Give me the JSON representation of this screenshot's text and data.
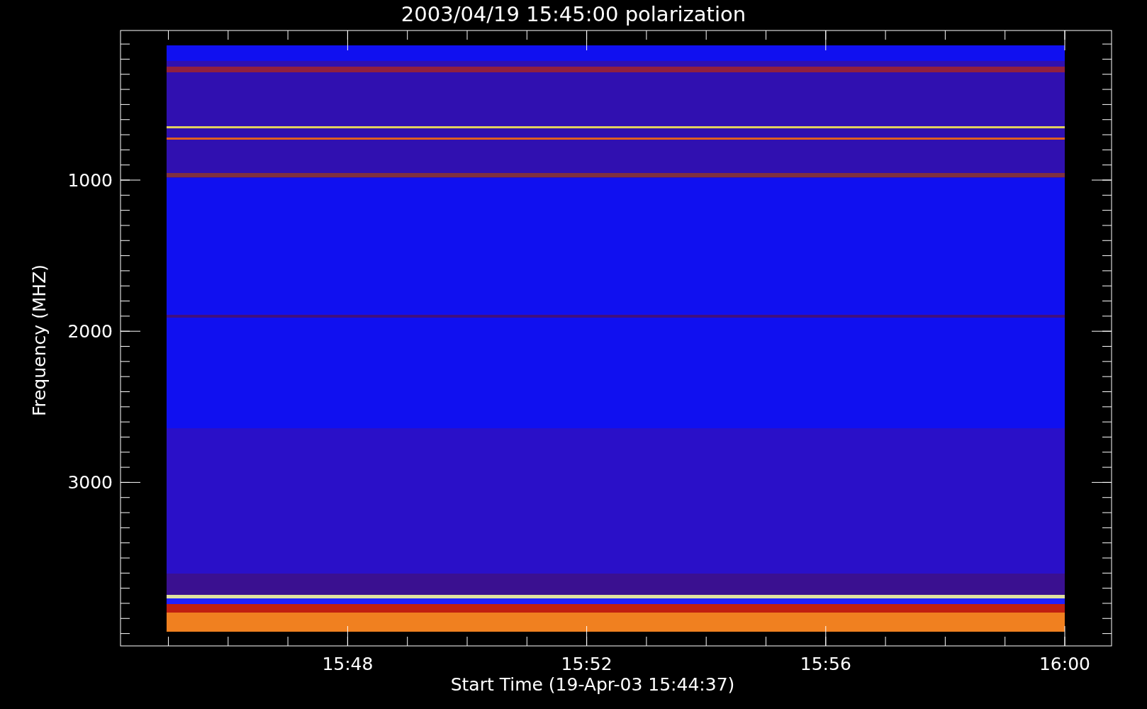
{
  "title": "2003/04/19 15:45:00 polarization",
  "y_axis": {
    "label": "Frequency (MHZ)",
    "ticks": [
      "1000",
      "2000",
      "3000"
    ]
  },
  "x_axis": {
    "label": "Start Time (19-Apr-03 15:44:37)",
    "ticks": [
      "15:48",
      "15:52",
      "15:56",
      "16:00"
    ]
  }
}
